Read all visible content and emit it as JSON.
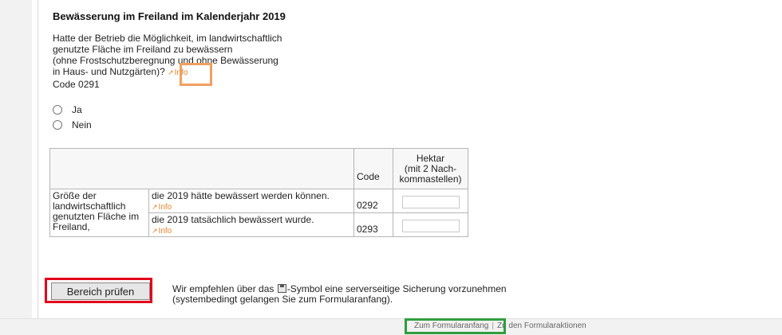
{
  "section_title": "Bewässerung im Freiland im Kalenderjahr 2019",
  "question": {
    "line1": "Hatte der Betrieb die Möglichkeit, im landwirtschaftlich",
    "line2": "genutzte Fläche im Freiland zu bewässern",
    "line3": "(ohne Frostschutzberegnung und ohne Bewässerung",
    "line4": "in Haus- und Nutzgärten)?",
    "info_label": "Info",
    "code": "Code 0291"
  },
  "options": {
    "yes": "Ja",
    "no": "Nein"
  },
  "table": {
    "col_code": "Code",
    "col_hektar_line1": "Hektar",
    "col_hektar_line2": "(mit 2 Nach-",
    "col_hektar_line3": "kommastellen)",
    "row_label": "Größe der landwirtschaftlich genutzten Fläche im Freiland,",
    "rows": [
      {
        "desc": "die 2019 hätte bewässert werden können.",
        "info": "Info",
        "code": "0292",
        "value": ""
      },
      {
        "desc": "die 2019 tatsächlich bewässert wurde.",
        "info": "Info",
        "code": "0293",
        "value": ""
      }
    ]
  },
  "check_button": "Bereich prüfen",
  "note": {
    "line1_before": "Wir empfehlen über das",
    "line1_after": "-Symbol eine serverseitige Sicherung vorzunehmen",
    "line2": "(systembedingt gelangen Sie zum Formularanfang).",
    "icon": "save-icon"
  },
  "footer": {
    "link1": "Zum Formularanfang",
    "separator": "|",
    "link2": "Zu den Formularaktionen"
  },
  "colors": {
    "info_link": "#e8842c",
    "highlight_orange": "#f0a060",
    "highlight_red": "#e3001b",
    "highlight_green": "#2e9e3e"
  }
}
